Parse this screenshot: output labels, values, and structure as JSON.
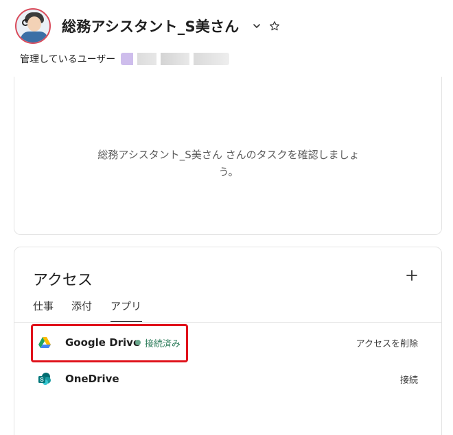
{
  "header": {
    "title": "総務アシスタント_S美さん",
    "managed_label": "管理しているユーザー"
  },
  "tasks": {
    "message": "総務アシスタント_S美さん さんのタスクを確認しましょう。"
  },
  "access": {
    "title": "アクセス",
    "tabs": [
      {
        "label": "仕事",
        "active": false
      },
      {
        "label": "添付",
        "active": false
      },
      {
        "label": "アプリ",
        "active": true
      }
    ],
    "apps": [
      {
        "name": "Google Drive",
        "status": "接続済み",
        "action": "アクセスを削除",
        "icon": "google-drive-icon"
      },
      {
        "name": "OneDrive",
        "status": "",
        "action": "接続",
        "icon": "sharepoint-icon"
      }
    ]
  },
  "colors": {
    "accent_green": "#2f7d5c",
    "highlight_red": "#e0121b",
    "avatar_ring": "#d94a5a"
  }
}
